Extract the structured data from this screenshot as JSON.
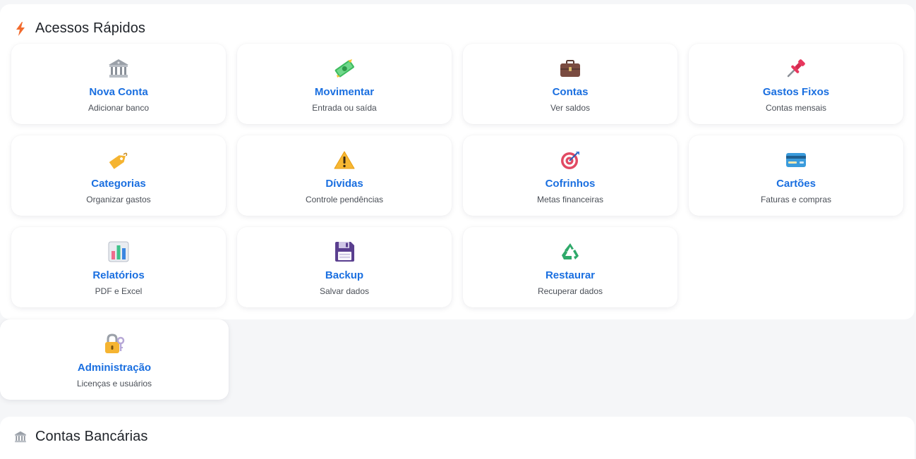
{
  "quick_access": {
    "title": "Acessos Rápidos",
    "icon": "lightning-icon",
    "cards": [
      {
        "label": "Nova Conta",
        "sub": "Adicionar banco",
        "icon": "bank-icon"
      },
      {
        "label": "Movimentar",
        "sub": "Entrada ou saída",
        "icon": "money-icon"
      },
      {
        "label": "Contas",
        "sub": "Ver saldos",
        "icon": "briefcase-icon"
      },
      {
        "label": "Gastos Fixos",
        "sub": "Contas mensais",
        "icon": "pushpin-icon"
      },
      {
        "label": "Categorias",
        "sub": "Organizar gastos",
        "icon": "tag-icon"
      },
      {
        "label": "Dívidas",
        "sub": "Controle pendências",
        "icon": "warning-icon"
      },
      {
        "label": "Cofrinhos",
        "sub": "Metas financeiras",
        "icon": "target-icon"
      },
      {
        "label": "Cartões",
        "sub": "Faturas e compras",
        "icon": "credit-card-icon"
      },
      {
        "label": "Relatórios",
        "sub": "PDF e Excel",
        "icon": "bar-chart-icon"
      },
      {
        "label": "Backup",
        "sub": "Salvar dados",
        "icon": "floppy-disk-icon"
      },
      {
        "label": "Restaurar",
        "sub": "Recuperar dados",
        "icon": "recycle-icon"
      },
      {
        "label": "Administração",
        "sub": "Licenças e usuários",
        "icon": "lock-key-icon"
      }
    ]
  },
  "bank_accounts": {
    "title": "Contas Bancárias",
    "icon": "bank-icon"
  },
  "colors": {
    "accent": "#1a6fe0",
    "bolt": "#f26b2e",
    "background": "#f5f6f8",
    "card": "#ffffff"
  }
}
